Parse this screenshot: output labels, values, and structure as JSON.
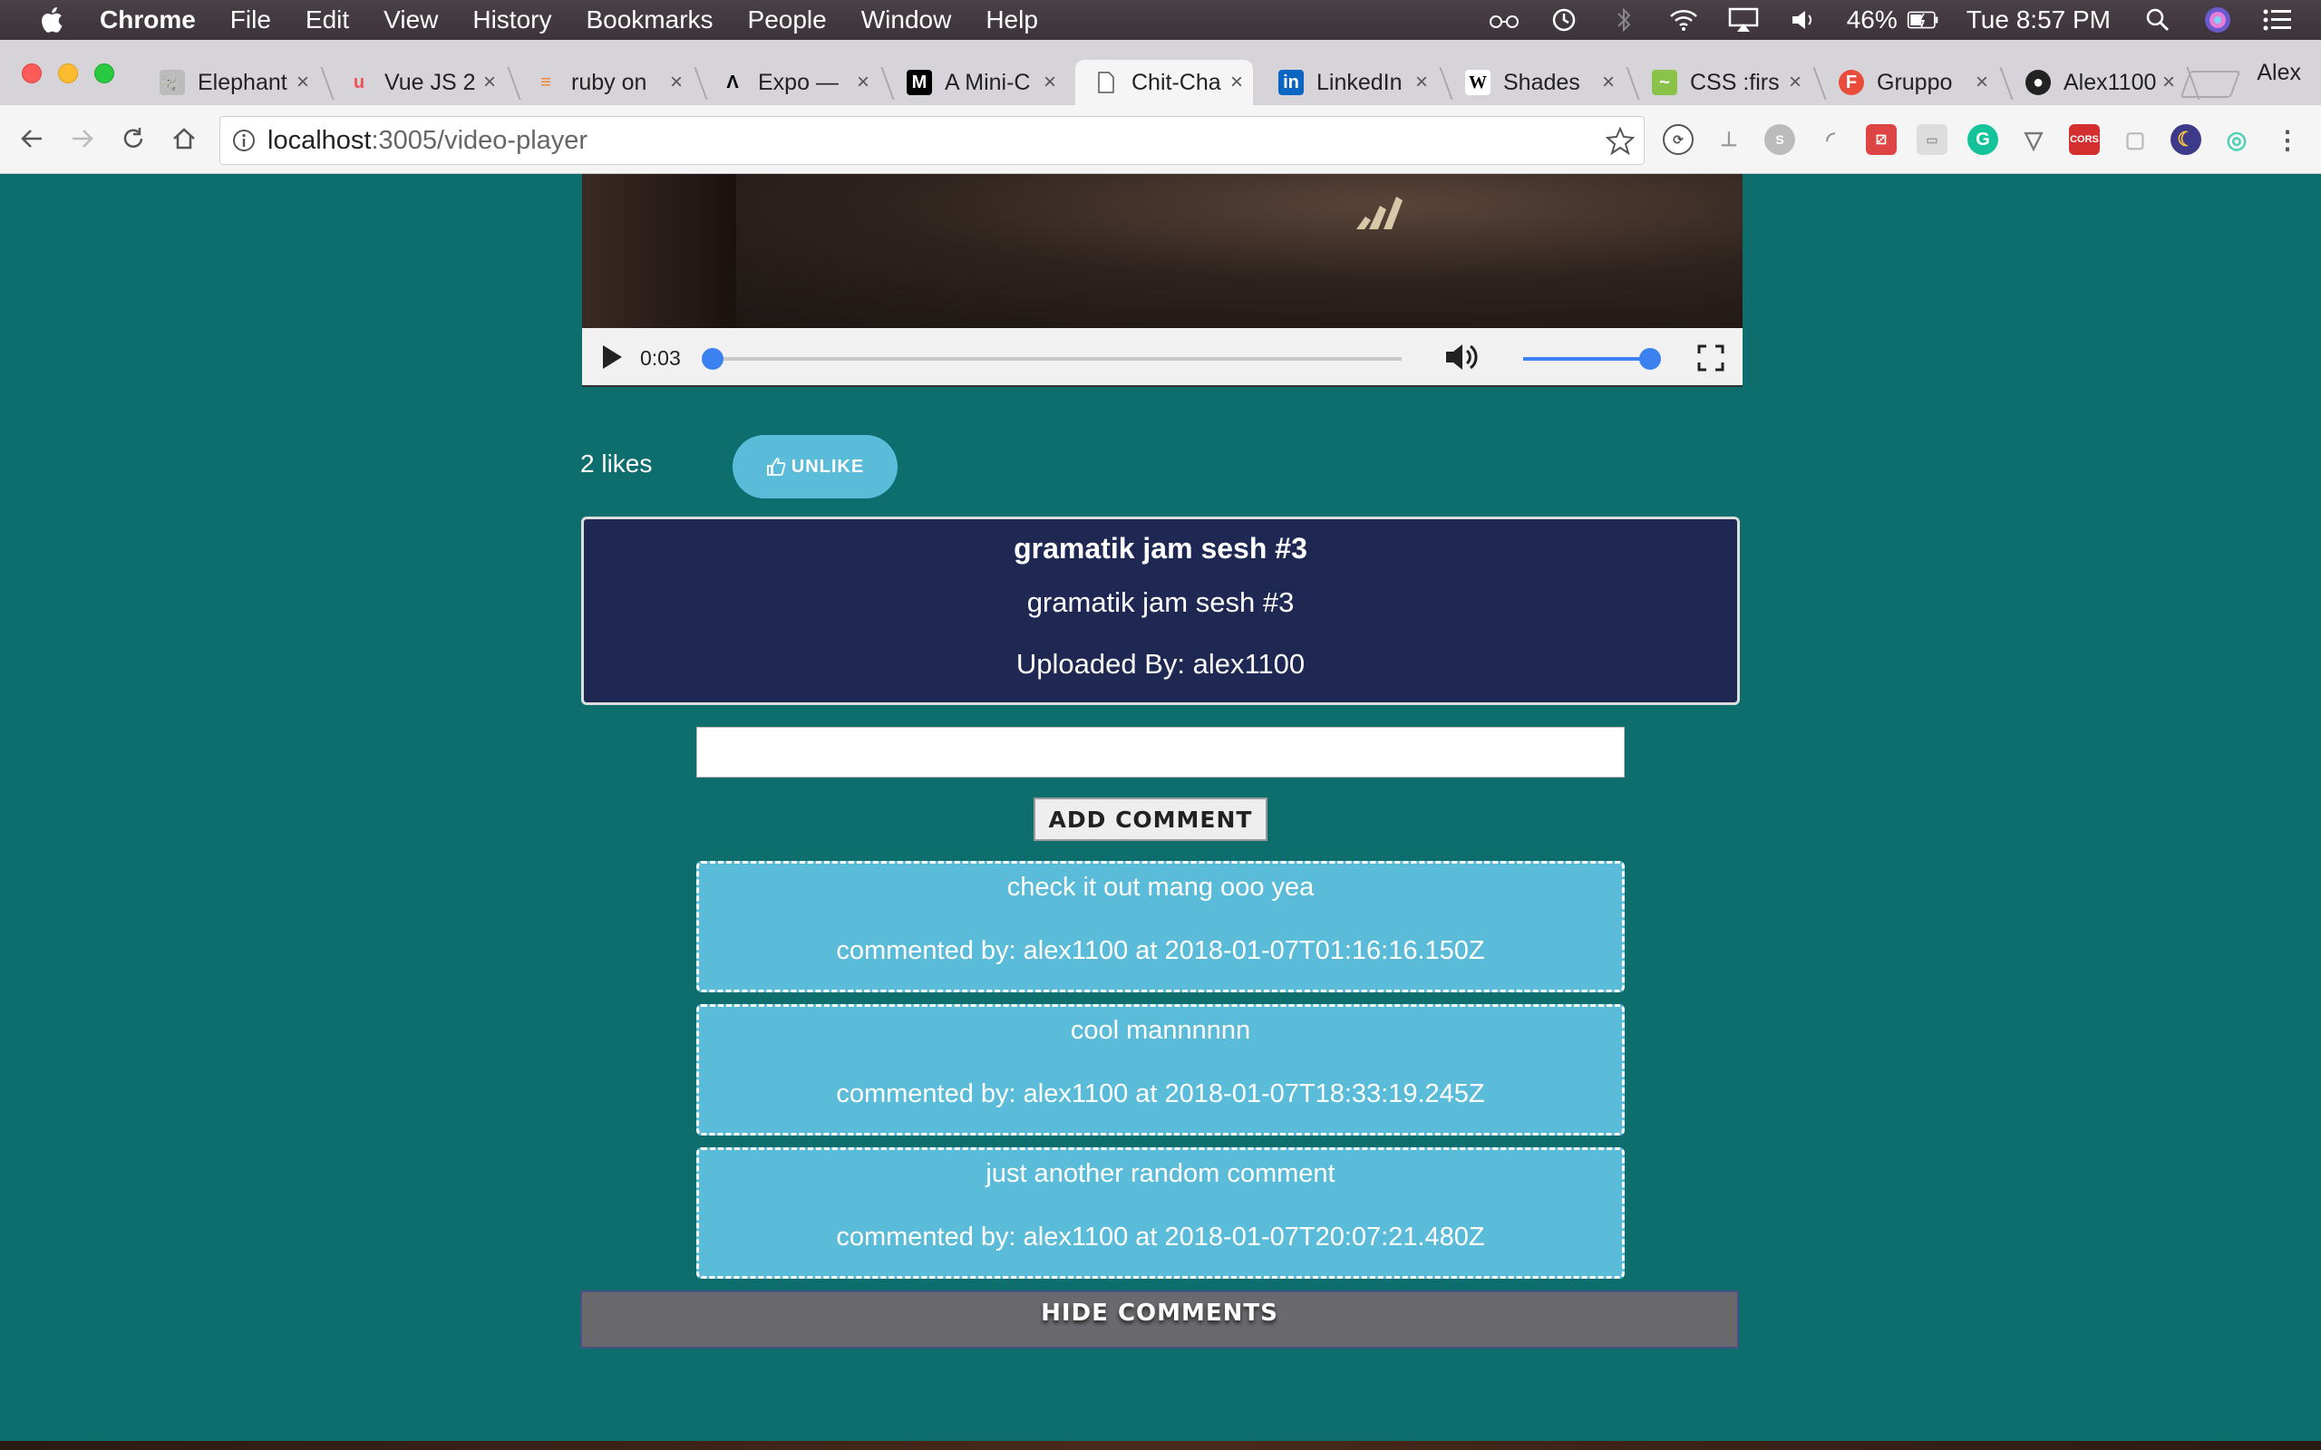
{
  "menubar": {
    "app_name": "Chrome",
    "items": [
      "File",
      "Edit",
      "View",
      "History",
      "Bookmarks",
      "People",
      "Window",
      "Help"
    ],
    "battery": "46%",
    "clock": "Tue 8:57 PM"
  },
  "tabs": [
    {
      "label": "Elephant",
      "favicon": "elephant-icon"
    },
    {
      "label": "Vue JS 2",
      "favicon": "udemy-icon"
    },
    {
      "label": "ruby on",
      "favicon": "stackoverflow-icon"
    },
    {
      "label": "Expo —",
      "favicon": "expo-icon"
    },
    {
      "label": "A Mini-C",
      "favicon": "medium-icon"
    },
    {
      "label": "Chit-Cha",
      "favicon": "document-icon",
      "active": true
    },
    {
      "label": "LinkedIn",
      "favicon": "linkedin-icon"
    },
    {
      "label": "Shades",
      "favicon": "wikipedia-icon"
    },
    {
      "label": "CSS :firs",
      "favicon": "css-icon"
    },
    {
      "label": "Gruppo",
      "favicon": "font-icon"
    },
    {
      "label": "Alex1100",
      "favicon": "github-icon"
    }
  ],
  "profile_name": "Alex",
  "address_bar": {
    "host": "localhost",
    "path": ":3005/video-player"
  },
  "video": {
    "time": "0:03",
    "progress": 0.0,
    "volume": 1.0
  },
  "likes": {
    "count_label": "2 likes",
    "unlike_label": "UNLIKE"
  },
  "info": {
    "title": "gramatik jam sesh #3",
    "description": "gramatik jam sesh #3",
    "uploaded_by": "Uploaded By: alex1100"
  },
  "comment_form": {
    "value": "",
    "button_label": "ADD COMMENT"
  },
  "comments": [
    {
      "text": "check it out mang ooo yea",
      "meta": "commented by: alex1100 at 2018-01-07T01:16:16.150Z"
    },
    {
      "text": "cool mannnnnn",
      "meta": "commented by: alex1100 at 2018-01-07T18:33:19.245Z"
    },
    {
      "text": "just another random comment",
      "meta": "commented by: alex1100 at 2018-01-07T20:07:21.480Z"
    }
  ],
  "hide_comments_label": "HIDE COMMENTS",
  "colors": {
    "page_bg": "#0e6e6e",
    "card_bg": "#1f2853",
    "comment_bg": "#5bbcd9",
    "accent_blue": "#3b82f0"
  }
}
